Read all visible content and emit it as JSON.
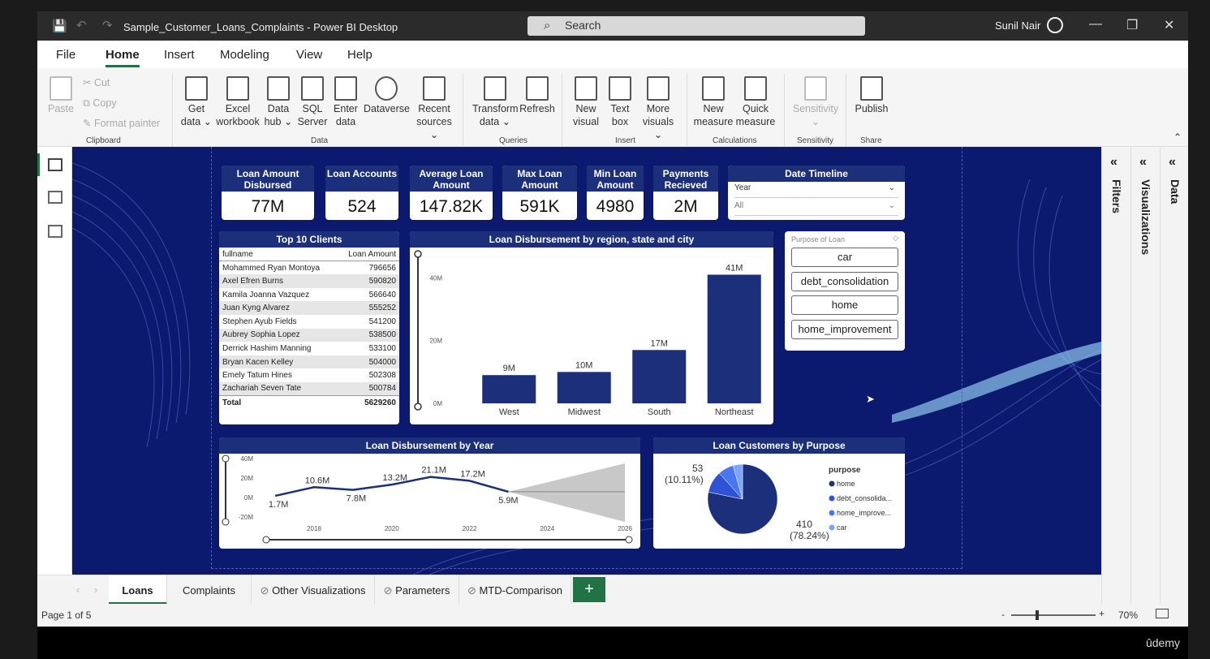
{
  "window": {
    "title": "Sample_Customer_Loans_Complaints - Power BI Desktop",
    "search_placeholder": "Search",
    "user": "Sunil Nair"
  },
  "menu": [
    "File",
    "Home",
    "Insert",
    "Modeling",
    "View",
    "Help"
  ],
  "ribbon": {
    "clipboard": {
      "paste": "Paste",
      "cut": "Cut",
      "copy": "Copy",
      "format_painter": "Format painter",
      "group": "Clipboard"
    },
    "data": {
      "get_data": [
        "Get",
        "data ⌄"
      ],
      "excel": [
        "Excel",
        "workbook"
      ],
      "data_hub": [
        "Data",
        "hub ⌄"
      ],
      "sql": [
        "SQL",
        "Server"
      ],
      "enter": [
        "Enter",
        "data"
      ],
      "dataverse": "Dataverse",
      "recent": [
        "Recent",
        "sources ⌄"
      ],
      "group": "Data"
    },
    "queries": {
      "transform": [
        "Transform",
        "data ⌄"
      ],
      "refresh": "Refresh",
      "group": "Queries"
    },
    "insert": {
      "new_visual": [
        "New",
        "visual"
      ],
      "text_box": [
        "Text",
        "box"
      ],
      "more_visuals": [
        "More",
        "visuals ⌄"
      ],
      "group": "Insert"
    },
    "calculations": {
      "new_measure": [
        "New",
        "measure"
      ],
      "quick_measure": [
        "Quick",
        "measure"
      ],
      "group": "Calculations"
    },
    "sensitivity": {
      "label": "Sensitivity",
      "group": "Sensitivity"
    },
    "share": {
      "publish": "Publish",
      "group": "Share"
    }
  },
  "kpis": [
    {
      "label": "Loan Amount Disbursed",
      "value": "77M"
    },
    {
      "label": "Loan Accounts",
      "value": "524"
    },
    {
      "label": "Average Loan Amount",
      "value": "147.82K"
    },
    {
      "label": "Max Loan Amount",
      "value": "591K"
    },
    {
      "label": "Min Loan Amount",
      "value": "4980"
    },
    {
      "label": "Payments Recieved",
      "value": "2M"
    }
  ],
  "date_timeline": {
    "title": "Date Timeline",
    "level": "Year",
    "value": "All"
  },
  "top_clients": {
    "title": "Top 10 Clients",
    "headers": [
      "fullname",
      "Loan Amount"
    ],
    "rows": [
      [
        "Mohammed Ryan Montoya",
        "796656"
      ],
      [
        "Axel Efren Burns",
        "590820"
      ],
      [
        "Kamila Joanna Vazquez",
        "566640"
      ],
      [
        "Juan Kyng Alvarez",
        "555252"
      ],
      [
        "Stephen Ayub Fields",
        "541200"
      ],
      [
        "Aubrey Sophia Lopez",
        "538500"
      ],
      [
        "Derrick Hashim Manning",
        "533100"
      ],
      [
        "Bryan Kacen Kelley",
        "504000"
      ],
      [
        "Emely Tatum Hines",
        "502308"
      ],
      [
        "Zachariah Seven Tate",
        "500784"
      ]
    ],
    "total": [
      "Total",
      "5629260"
    ]
  },
  "purpose_slicer": {
    "title": "Purpose of Loan",
    "items": [
      "car",
      "debt_consolidation",
      "home",
      "home_improvement"
    ]
  },
  "pie_legend_title": "purpose",
  "tabs": [
    "Loans",
    "Complaints",
    "Other Visualizations",
    "Parameters",
    "MTD-Comparison"
  ],
  "panes": [
    "Filters",
    "Visualizations",
    "Data"
  ],
  "status": {
    "page": "Page 1 of 5",
    "zoom": "70%"
  },
  "watermark": "ûdemy",
  "colors": {
    "navy": "#1c2f7a",
    "canvas": "#0b1a6e",
    "accent": "#217346"
  },
  "chart_data": [
    {
      "type": "bar",
      "title": "Loan Disbursement by region, state and city",
      "categories": [
        "West",
        "Midwest",
        "South",
        "Northeast"
      ],
      "values": [
        9,
        10,
        17,
        41
      ],
      "data_labels": [
        "9M",
        "10M",
        "17M",
        "41M"
      ],
      "yticks": [
        "0M",
        "20M",
        "40M"
      ],
      "ylim": [
        0,
        45
      ]
    },
    {
      "type": "line",
      "title": "Loan Disbursement by Year",
      "x": [
        2017,
        2018,
        2019,
        2020,
        2021,
        2022,
        2023
      ],
      "values": [
        1.7,
        10.6,
        7.8,
        13.2,
        21.1,
        17.2,
        5.9
      ],
      "data_labels": [
        "1.7M",
        "10.6M",
        "7.8M",
        "13.2M",
        "21.1M",
        "17.2M",
        "5.9M"
      ],
      "forecast": {
        "x": [
          2023,
          2026
        ],
        "center": [
          5.9,
          5.9
        ],
        "upper": [
          5.9,
          35
        ],
        "lower": [
          5.9,
          -25
        ]
      },
      "xticks": [
        "2018",
        "2020",
        "2022",
        "2024",
        "2026"
      ],
      "yticks": [
        "-20M",
        "0M",
        "20M",
        "40M"
      ],
      "ylim": [
        -25,
        40
      ],
      "xlim": [
        2016.6,
        2026
      ]
    },
    {
      "type": "pie",
      "title": "Loan Customers by Purpose",
      "legend_title": "purpose",
      "slices": [
        {
          "name": "home",
          "value": 410,
          "label": "410",
          "pct_label": "(78.24%)",
          "color": "#1c2f7a"
        },
        {
          "name": "debt_consolida...",
          "value": 53,
          "label": "53",
          "pct_label": "(10.11%)",
          "color": "#2f53d6"
        },
        {
          "name": "home_improve...",
          "value": 38,
          "label": "",
          "pct_label": "",
          "color": "#4a76f0"
        },
        {
          "name": "car",
          "value": 23,
          "label": "",
          "pct_label": "",
          "color": "#7aa6ff"
        }
      ]
    }
  ]
}
